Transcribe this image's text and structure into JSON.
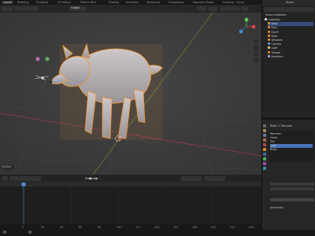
{
  "workspace_tabs": [
    "Layout",
    "Modeling",
    "Sculpting",
    "UV Editing",
    "Texture Paint",
    "Shading",
    "Animation",
    "Rendering",
    "Compositing",
    "Geometry Nodes",
    "Scripting"
  ],
  "active_tab_index": 0,
  "scene_label": "Scene",
  "viewport": {
    "orientation": "Global",
    "overlay_text": "(1) Collection | Raccoon",
    "footer_text": "Toolbar"
  },
  "timeline": {
    "current_frame": "1",
    "frame_marks": [
      "0",
      "20",
      "40",
      "60",
      "80",
      "100",
      "120",
      "140",
      "160",
      "180",
      "200",
      "220",
      "240"
    ]
  },
  "outliner": {
    "title": "Scene Collection",
    "items": [
      {
        "label": "Collection",
        "indent": 0,
        "icon": "collection-icon",
        "selected": false
      },
      {
        "label": "Body",
        "indent": 1,
        "icon": "mesh-icon",
        "selected": true
      },
      {
        "label": "Eye.L",
        "indent": 1,
        "icon": "mesh-icon",
        "selected": false
      },
      {
        "label": "Eye.R",
        "indent": 1,
        "icon": "mesh-icon",
        "selected": false
      },
      {
        "label": "Nose",
        "indent": 1,
        "icon": "mesh-icon",
        "selected": false
      },
      {
        "label": "Whiskers",
        "indent": 1,
        "icon": "mesh-icon",
        "selected": false
      },
      {
        "label": "Camera",
        "indent": 1,
        "icon": "camera-icon",
        "selected": false
      },
      {
        "label": "Light",
        "indent": 1,
        "icon": "light-icon",
        "selected": false
      },
      {
        "label": "Tongue",
        "indent": 1,
        "icon": "mesh-icon",
        "selected": false
      },
      {
        "label": "Armature",
        "indent": 1,
        "icon": "armature-icon",
        "selected": false
      }
    ]
  },
  "properties": {
    "breadcrumb": [
      "Body",
      "Raccoon"
    ],
    "rows": [
      "Raccoon",
      "Head",
      "Tail",
      "Legs",
      "Body"
    ],
    "selected_row_index": 3,
    "section": "Attributes"
  },
  "colors": {
    "accent": "#4772b3",
    "selection_orange": "#f5962e",
    "mesh_gray": "#b8bccb"
  }
}
